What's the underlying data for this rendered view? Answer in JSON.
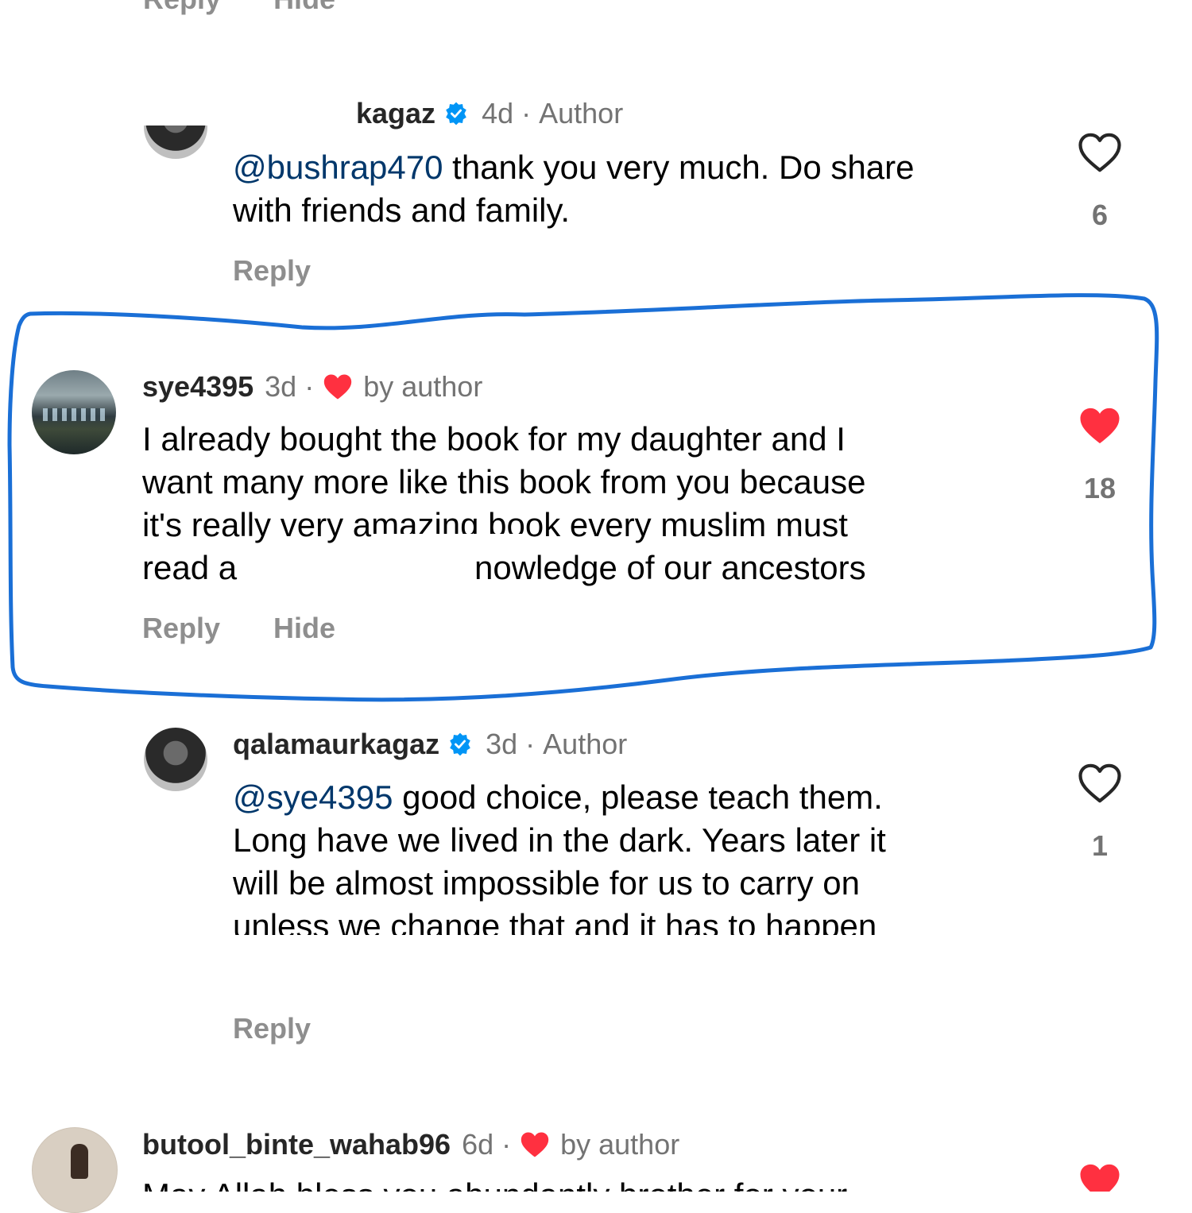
{
  "top_cut": {
    "reply_label": "Reply",
    "hide_label": "Hide"
  },
  "comments": [
    {
      "username": "kagaz",
      "time": "4d",
      "tag": "Author",
      "mention": "@bushrap470",
      "text_lines": [
        " thank you very much. Do share",
        "with friends and family."
      ],
      "likes": "6",
      "reply_label": "Reply"
    },
    {
      "username": "sye4395",
      "time": "3d",
      "tag": "by author",
      "text_lines": [
        "I already bought the book for my daughter and I",
        "want many more like this book from you because",
        "it's really very amazing book every muslim must",
        "read a",
        "nowledge of our ancestors"
      ],
      "likes": "18",
      "reply_label": "Reply",
      "hide_label": "Hide"
    },
    {
      "username": "qalamaurkagaz",
      "time": "3d",
      "tag": "Author",
      "mention": "@sye4395",
      "text_lines": [
        " good choice, please teach them.",
        "Long have we lived in the dark. Years later it",
        "will be almost impossible for us to carry on",
        "unless we change that and it has to happen"
      ],
      "likes": "1",
      "reply_label": "Reply"
    },
    {
      "username": "butool_binte_wahab96",
      "time": "6d",
      "tag": "by author",
      "text_partial": "May Allah bless you abundantly brother for your"
    }
  ],
  "colors": {
    "highlight": "#1a6fd6",
    "like_red": "#ff3040",
    "verified_blue": "#0095f6",
    "mention": "#00376b",
    "muted": "#8e8e8e"
  }
}
